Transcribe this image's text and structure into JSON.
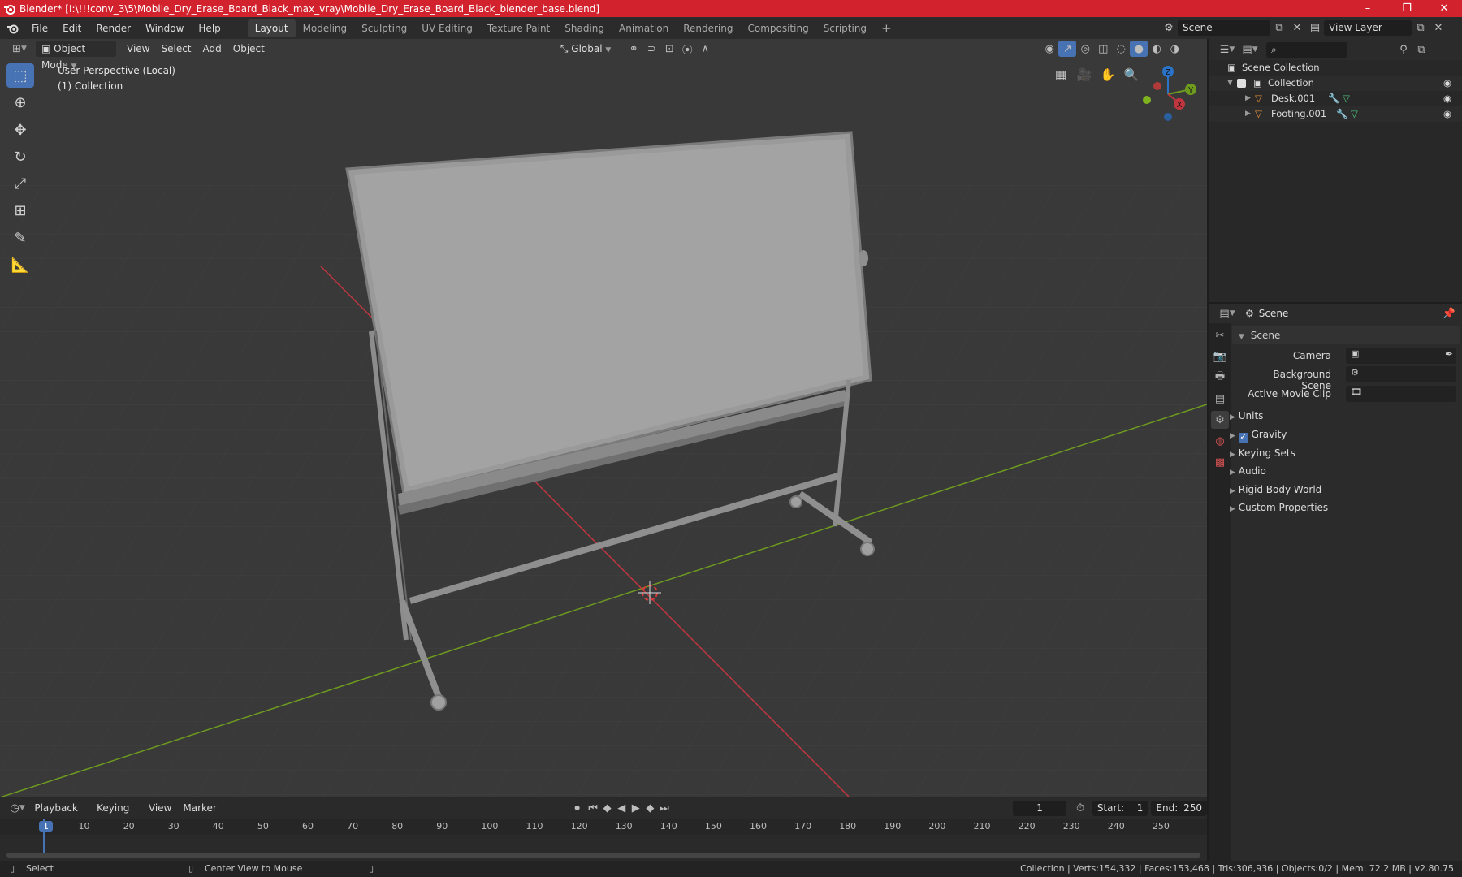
{
  "window": {
    "title": "Blender* [I:\\!!!conv_3\\5\\Mobile_Dry_Erase_Board_Black_max_vray\\Mobile_Dry_Erase_Board_Black_blender_base.blend]",
    "minimize": "–",
    "maximize": "❐",
    "close": "✕"
  },
  "menus": [
    "File",
    "Edit",
    "Render",
    "Window",
    "Help"
  ],
  "workspaces": [
    "Layout",
    "Modeling",
    "Sculpting",
    "UV Editing",
    "Texture Paint",
    "Shading",
    "Animation",
    "Rendering",
    "Compositing",
    "Scripting"
  ],
  "add_workspace": "+",
  "scene_selector": {
    "value": "Scene"
  },
  "view_layer_selector": {
    "value": "View Layer"
  },
  "viewport_header": {
    "mode": "Object Mode",
    "view": "View",
    "select": "Select",
    "add": "Add",
    "object": "Object",
    "orientation": "Global"
  },
  "viewport_info": {
    "perspective": "User Perspective (Local)",
    "collection": "(1) Collection"
  },
  "gizmo": {
    "x": "X",
    "y": "Y",
    "z": "Z"
  },
  "outliner": {
    "root": "Scene Collection",
    "collection": "Collection",
    "objects": [
      {
        "name": "Desk.001"
      },
      {
        "name": "Footing.001"
      }
    ]
  },
  "properties": {
    "context": "Scene",
    "panel": "Scene",
    "fields": [
      {
        "label": "Camera"
      },
      {
        "label": "Background Scene"
      },
      {
        "label": "Active Movie Clip"
      }
    ],
    "subpanels": [
      "Units",
      "Gravity",
      "Keying Sets",
      "Audio",
      "Rigid Body World",
      "Custom Properties"
    ],
    "gravity_checked": true
  },
  "timeline": {
    "menus": [
      "Playback",
      "Keying",
      "View",
      "Marker"
    ],
    "current_frame": "1",
    "start_label": "Start:",
    "start": "1",
    "end_label": "End:",
    "end": "250",
    "ruler": [
      "1",
      "10",
      "20",
      "30",
      "40",
      "50",
      "60",
      "70",
      "80",
      "90",
      "100",
      "110",
      "120",
      "130",
      "140",
      "150",
      "160",
      "170",
      "180",
      "190",
      "200",
      "210",
      "220",
      "230",
      "240",
      "250"
    ]
  },
  "status": {
    "select": "Select",
    "center": "Center View to Mouse",
    "stats": "Collection | Verts:154,332 | Faces:153,468 | Tris:306,936 | Objects:0/2 | Mem: 72.2 MB | v2.80.75"
  },
  "colors": {
    "title_bar": "#d2222d",
    "accent": "#4772b3",
    "x_axis": "#c0363f",
    "y_axis": "#6d9a1f",
    "z_axis": "#2a73c9"
  }
}
